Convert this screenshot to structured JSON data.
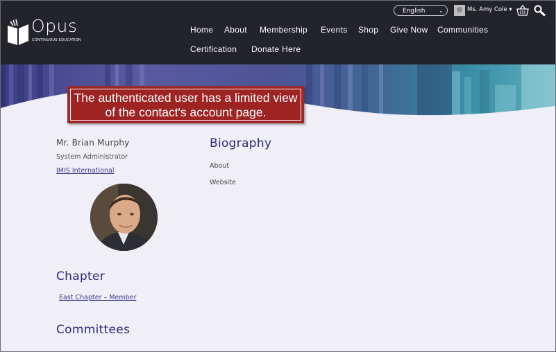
{
  "header": {
    "logo": {
      "word": "Opus",
      "tagline": "CONTINUOUS EDUCATION"
    },
    "language": {
      "selected": "English"
    },
    "user": {
      "name": "Ms. Amy Cole ▾"
    },
    "nav": {
      "home": "Home",
      "about": "About",
      "membership": "Membership",
      "events": "Events",
      "shop": "Shop",
      "give_now": "Give Now",
      "communities": "Communities",
      "certification": "Certification",
      "donate_here": "Donate Here"
    }
  },
  "callout": {
    "text": "The authenticated user has a limited view of the contact's account page."
  },
  "profile": {
    "name": "Mr. Brian Murphy",
    "title": "System Administrator",
    "organization": "IMIS International"
  },
  "chapter": {
    "heading": "Chapter",
    "link": "East Chapter – Member"
  },
  "committees": {
    "heading": "Committees"
  },
  "biography": {
    "heading": "Biography",
    "about": "About",
    "website": "Website"
  },
  "colors": {
    "header_bg": "#22232b",
    "heading": "#2b2b7a",
    "callout": "#9e2323",
    "page_bg": "#f0eef6"
  }
}
